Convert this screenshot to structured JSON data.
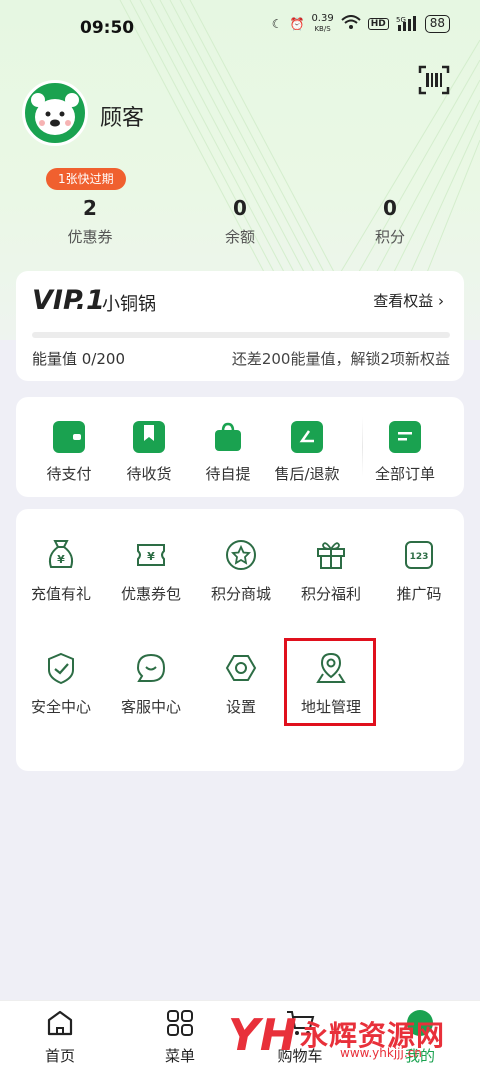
{
  "status_bar": {
    "time": "09:50",
    "speed": "0.39",
    "speed_unit": "KB/S",
    "battery": "88",
    "hd": "HD",
    "net": "5G"
  },
  "profile": {
    "username": "顾客"
  },
  "stats": {
    "expire_badge": "1张快过期",
    "items": [
      {
        "value": "2",
        "label": "优惠券"
      },
      {
        "value": "0",
        "label": "余额"
      },
      {
        "value": "0",
        "label": "积分"
      }
    ]
  },
  "vip": {
    "level": "VIP.1",
    "name": "小铜锅",
    "link": "查看权益 ›",
    "energy": "能量值 0/200",
    "unlock_hint": "还差200能量值，解锁2项新权益",
    "progress": 0
  },
  "orders": [
    {
      "label": "待支付",
      "icon": "wallet-icon"
    },
    {
      "label": "待收货",
      "icon": "bookmark-icon"
    },
    {
      "label": "待自提",
      "icon": "bag-icon"
    },
    {
      "label": "售后/退款",
      "icon": "refund-icon"
    },
    {
      "label": "全部订单",
      "icon": "order-list-icon"
    }
  ],
  "functions": [
    {
      "label": "充值有礼",
      "icon": "money-bag-icon"
    },
    {
      "label": "优惠券包",
      "icon": "coupon-icon"
    },
    {
      "label": "积分商城",
      "icon": "star-coin-icon"
    },
    {
      "label": "积分福利",
      "icon": "gift-icon"
    },
    {
      "label": "推广码",
      "icon": "code-icon"
    },
    {
      "label": "安全中心",
      "icon": "shield-icon"
    },
    {
      "label": "客服中心",
      "icon": "chat-icon"
    },
    {
      "label": "设置",
      "icon": "gear-icon"
    },
    {
      "label": "地址管理",
      "icon": "location-icon"
    }
  ],
  "tabbar": [
    {
      "label": "首页",
      "icon": "home-icon"
    },
    {
      "label": "菜单",
      "icon": "menu-grid-icon"
    },
    {
      "label": "购物车",
      "icon": "cart-icon"
    },
    {
      "label": "我的",
      "icon": "profile-icon"
    }
  ],
  "watermark": {
    "text": "永辉资源网",
    "url": "www.yhkjjj.cn",
    "logo": "YH"
  },
  "colors": {
    "brand": "#1aa250",
    "badge": "#f0602f",
    "highlight": "#e0101d"
  }
}
